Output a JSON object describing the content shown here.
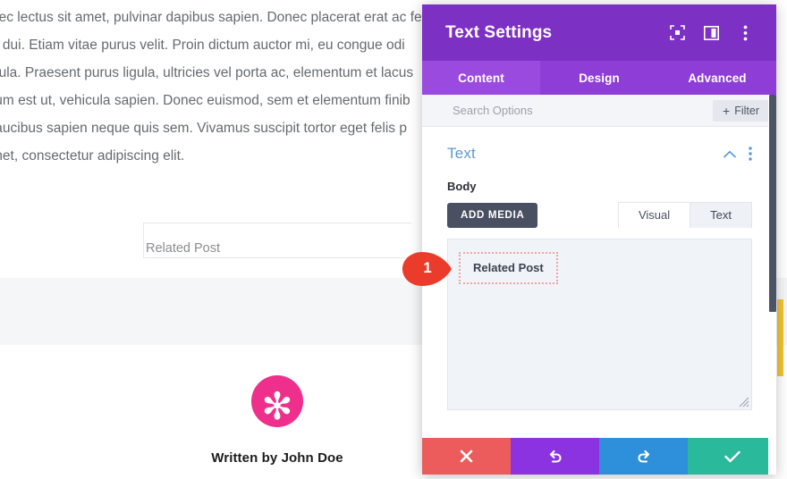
{
  "page": {
    "article_lines": [
      "nec lectus sit amet, pulvinar dapibus sapien. Donec placerat erat ac fe",
      "e dui. Etiam vitae purus velit. Proin dictum auctor mi, eu congue odi",
      "gula. Praesent purus ligula, ultricies vel porta ac, elementum et lacus",
      "tum est ut, vehicula sapien. Donec euismod, sem et elementum finib",
      " faucibus sapien neque quis sem. Vivamus suscipit tortor eget felis p",
      "met, consectetur adipiscing elit."
    ],
    "related_post_label": "Related Post",
    "author_name": "Written by John Doe",
    "avatar_glyph": "✻"
  },
  "modal": {
    "title": "Text Settings",
    "header_icons": [
      {
        "name": "focus-icon"
      },
      {
        "name": "layout-pane-icon"
      },
      {
        "name": "more-vertical-icon"
      }
    ],
    "tabs": [
      {
        "label": "Content",
        "active": true
      },
      {
        "label": "Design",
        "active": false
      },
      {
        "label": "Advanced",
        "active": false
      }
    ],
    "search": {
      "placeholder": "Search Options",
      "value": ""
    },
    "filter_button": {
      "label": "Filter",
      "plus": "+"
    },
    "section": {
      "title": "Text",
      "collapse_icon": "chevron-up-icon",
      "menu_icon": "more-vertical-icon"
    },
    "body_field": {
      "label": "Body",
      "add_media_label": "ADD MEDIA",
      "view_tabs": [
        {
          "label": "Visual",
          "active": false
        },
        {
          "label": "Text",
          "active": true
        }
      ],
      "content_snippet": "Related Post"
    },
    "footer_buttons": [
      {
        "name": "cancel-button",
        "icon": "close-icon",
        "color": "#ec5c5c"
      },
      {
        "name": "undo-button",
        "icon": "undo-icon",
        "color": "#8b33e0"
      },
      {
        "name": "redo-button",
        "icon": "redo-icon",
        "color": "#2e8fdb"
      },
      {
        "name": "save-button",
        "icon": "check-icon",
        "color": "#2bb99b"
      }
    ]
  },
  "annotation": {
    "marker_number": "1"
  },
  "colors": {
    "header_purple": "#7d30c4",
    "tab_bar_purple": "#8e3ed6",
    "active_tab_purple": "#9b4ae0",
    "section_title_blue": "#5d9ad4",
    "avatar_pink": "#ef2f8c",
    "marker_red": "#eb3b2b",
    "accent_yellow": "#f2c335",
    "dashed_border_pink": "#efa5a5"
  }
}
